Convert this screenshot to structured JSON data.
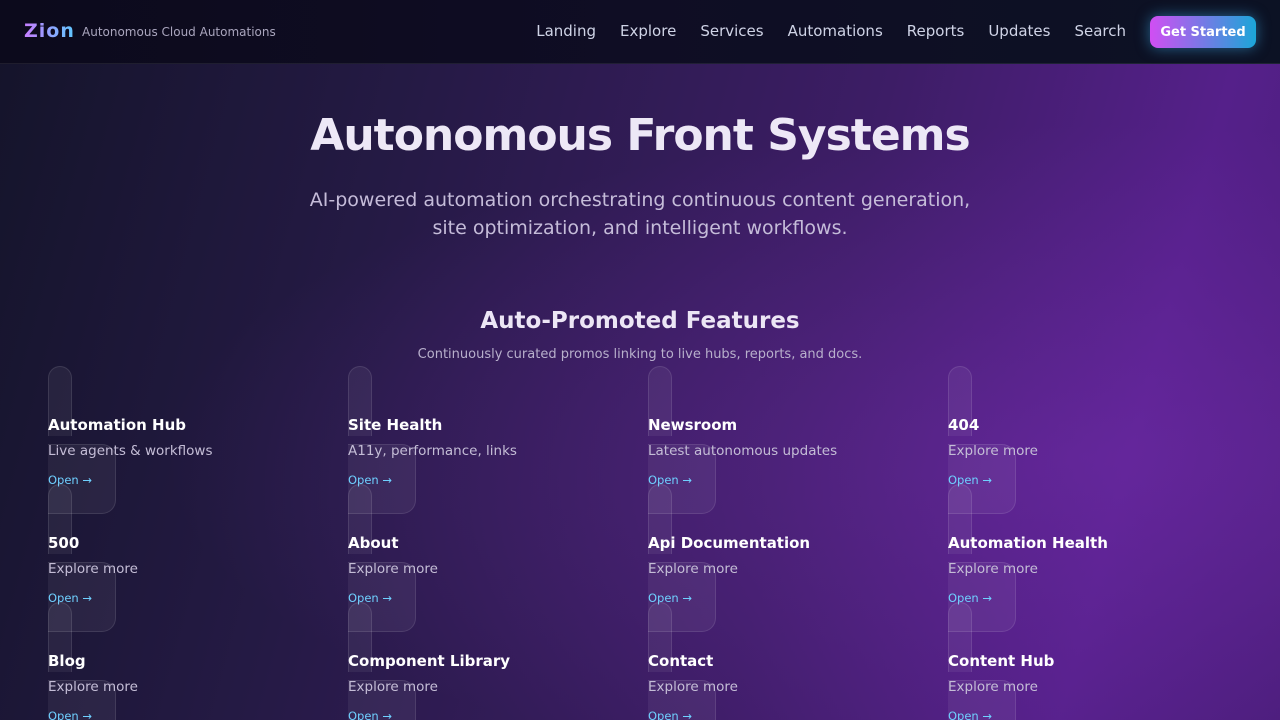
{
  "header": {
    "brand": "Zion",
    "tagline": "Autonomous Cloud Automations",
    "nav": [
      "Landing",
      "Explore",
      "Services",
      "Automations",
      "Reports",
      "Updates",
      "Search"
    ],
    "cta": "Get Started"
  },
  "hero": {
    "title": "Autonomous Front Systems",
    "subtitle": "AI-powered automation orchestrating continuous content generation, site optimization, and intelligent workflows."
  },
  "features": {
    "title": "Auto-Promoted Features",
    "subtitle": "Continuously curated promos linking to live hubs, reports, and docs.",
    "link_label": "Open →",
    "cards": [
      {
        "title": "Automation Hub",
        "desc": "Live agents & workflows"
      },
      {
        "title": "Site Health",
        "desc": "A11y, performance, links"
      },
      {
        "title": "Newsroom",
        "desc": "Latest autonomous updates"
      },
      {
        "title": "404",
        "desc": "Explore more"
      },
      {
        "title": "500",
        "desc": "Explore more"
      },
      {
        "title": "About",
        "desc": "Explore more"
      },
      {
        "title": "Api Documentation",
        "desc": "Explore more"
      },
      {
        "title": "Automation Health",
        "desc": "Explore more"
      },
      {
        "title": "Blog",
        "desc": "Explore more"
      },
      {
        "title": "Component Library",
        "desc": "Explore more"
      },
      {
        "title": "Contact",
        "desc": "Explore more"
      },
      {
        "title": "Content Hub",
        "desc": "Explore more"
      }
    ]
  },
  "colors": {
    "accent_start": "#d14ef3",
    "accent_end": "#1ba6d8",
    "link": "#6fd0ff"
  }
}
